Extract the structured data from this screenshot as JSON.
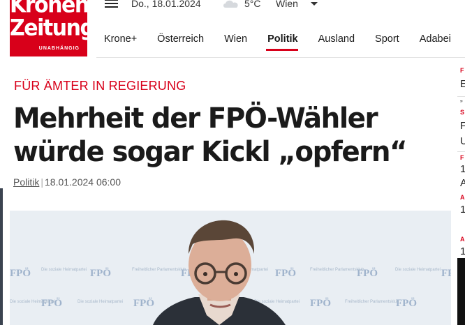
{
  "brand": {
    "logo_line1": "Kronen",
    "logo_line2": "Zeitung",
    "logo_tagline": "UNABHÄNGIG",
    "color": "#d8001a"
  },
  "topbar": {
    "menu_icon": "hamburger-menu-icon",
    "date": "Do., 18.01.2024",
    "weather_icon": "cloud-icon",
    "temperature": "5°C",
    "city": "Wien",
    "city_dropdown_icon": "caret-down-icon"
  },
  "nav": {
    "items": [
      "Krone+",
      "Österreich",
      "Wien",
      "Politik",
      "Ausland",
      "Sport",
      "Adabei"
    ],
    "active": "Politik"
  },
  "article": {
    "kicker": "FÜR ÄMTER IN REGIERUNG",
    "headline": "Mehrheit der FPÖ-Wähler würde sogar Kickl „opfern“",
    "category": "Politik",
    "separator": "|",
    "datetime": "18.01.2024 06:00"
  },
  "hero": {
    "backdrop_logo": "FPÖ",
    "backdrop_text_1": "Die soziale Heimatpartei",
    "backdrop_text_2": "Freiheitlicher Parlamentsklub"
  },
  "right_rail": {
    "partial_letters": [
      "F",
      "E",
      "„",
      "S",
      "F",
      "U",
      "F",
      "1",
      "A",
      "A",
      "1",
      "A",
      "1"
    ]
  }
}
